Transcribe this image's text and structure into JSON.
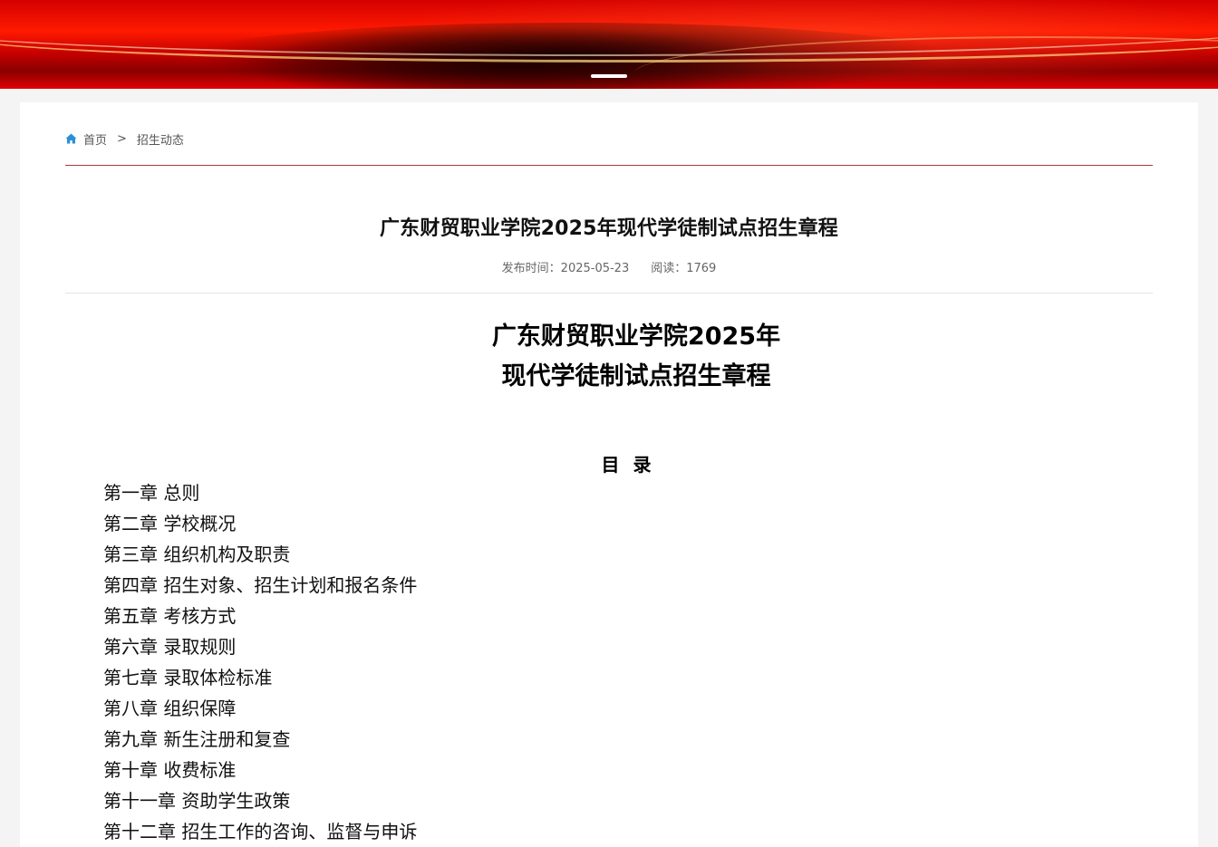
{
  "breadcrumb": {
    "home": "首页",
    "separator": ">",
    "current": "招生动态"
  },
  "article": {
    "title": "广东财贸职业学院2025年现代学徒制试点招生章程",
    "publish_label": "发布时间：2025-05-23",
    "read_label": "阅读：1769"
  },
  "document": {
    "title_line1": "广东财贸职业学院2025年",
    "title_line2": "现代学徒制试点招生章程",
    "toc_heading": "目 录",
    "toc": [
      "第一章 总则",
      "第二章 学校概况",
      "第三章 组织机构及职责",
      "第四章 招生对象、招生计划和报名条件",
      "第五章 考核方式",
      "第六章 录取规则",
      "第七章 录取体检标准",
      "第八章 组织保障",
      "第九章 新生注册和复查",
      "第十章 收费标准",
      "第十一章 资助学生政策",
      "第十二章  招生工作的咨询、监督与申诉"
    ]
  },
  "icons": {
    "home": "home-icon"
  },
  "colors": {
    "banner": "#d40000",
    "divider": "#a33a3a",
    "home_icon": "#2b8fd8"
  }
}
